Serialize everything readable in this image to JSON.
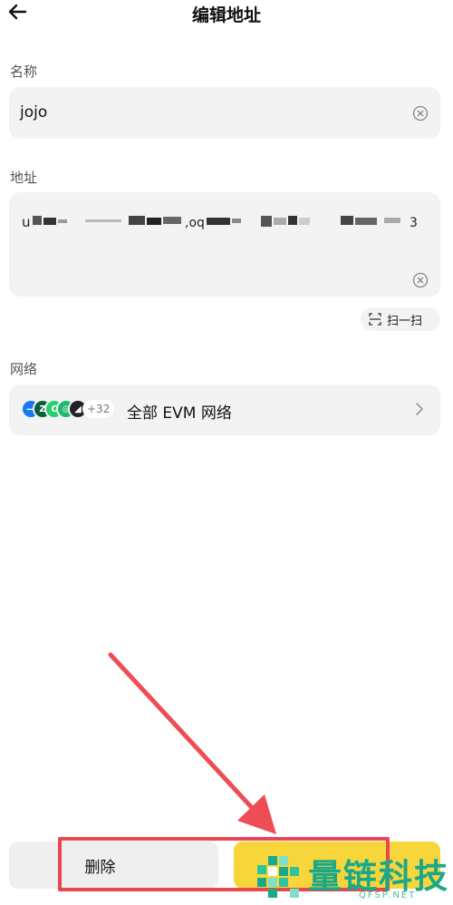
{
  "header": {
    "title": "编辑地址",
    "back_icon": "arrow-left-icon"
  },
  "name_section": {
    "label": "名称",
    "value": "jojo",
    "clear_icon": "clear-circle-icon"
  },
  "address_section": {
    "label": "地址",
    "value_note": "redacted",
    "clear_icon": "clear-circle-icon",
    "scan_label": "扫一扫",
    "scan_icon": "scan-icon"
  },
  "network_section": {
    "label": "网络",
    "selected": "全部 EVM 网络",
    "more_count": "+32",
    "chain_colors": [
      "#1877f2",
      "#0b5e3a",
      "#27d06b",
      "#1fb86e",
      "#222222"
    ],
    "chevron_icon": "chevron-right-icon"
  },
  "footer": {
    "delete_label": "删除",
    "save_color": "#f7d63b"
  },
  "annotation": {
    "arrow_color": "#e8474f"
  },
  "watermark": {
    "text": "量链科技",
    "sub": "QFSP.NET"
  }
}
